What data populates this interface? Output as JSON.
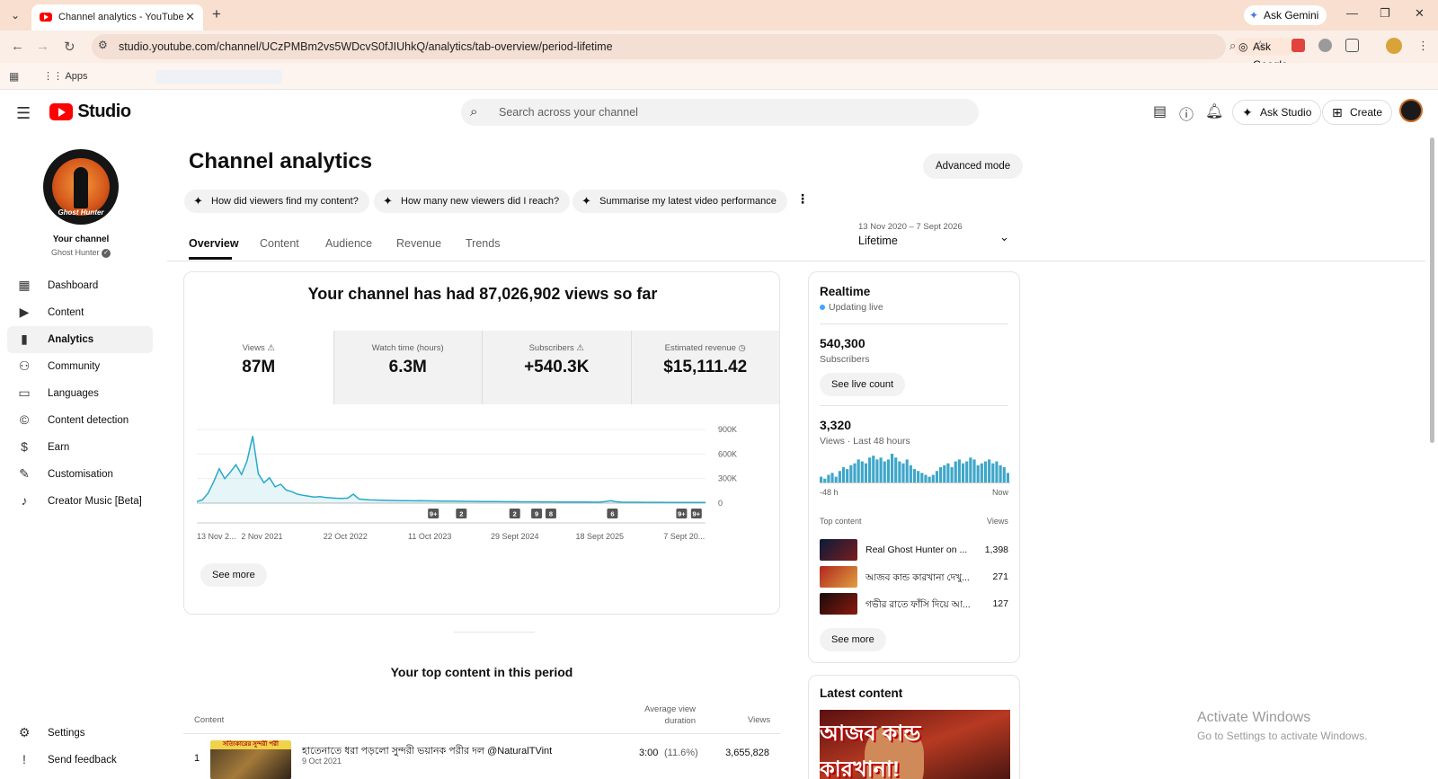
{
  "browser": {
    "tab_title": "Channel analytics - YouTube Studio",
    "ask_gemini": "Ask Gemini",
    "url": "studio.youtube.com/channel/UCzPMBm2vs5WDcvS0fJIUhkQ/analytics/tab-overview/period-lifetime",
    "ask_google": "Ask Google",
    "bookmarks_apps": "Apps"
  },
  "header": {
    "logo_text": "Studio",
    "search_placeholder": "Search across your channel",
    "ask_studio": "Ask Studio",
    "create": "Create"
  },
  "sidebar": {
    "your_channel": "Your channel",
    "channel_name": "Ghost Hunter",
    "avatar_caption": "Ghost Hunter",
    "items": [
      {
        "label": "Dashboard",
        "icon": "dashboard-icon"
      },
      {
        "label": "Content",
        "icon": "content-icon"
      },
      {
        "label": "Analytics",
        "icon": "analytics-icon",
        "active": true
      },
      {
        "label": "Community",
        "icon": "community-icon"
      },
      {
        "label": "Languages",
        "icon": "languages-icon"
      },
      {
        "label": "Content detection",
        "icon": "copyright-icon"
      },
      {
        "label": "Earn",
        "icon": "dollar-icon"
      },
      {
        "label": "Customisation",
        "icon": "wand-icon"
      },
      {
        "label": "Creator Music [Beta]",
        "icon": "music-icon"
      }
    ],
    "settings": "Settings",
    "feedback": "Send feedback"
  },
  "main": {
    "title": "Channel analytics",
    "advanced_mode": "Advanced mode",
    "chips": [
      "How did viewers find my content?",
      "How many new viewers did I reach?",
      "Summarise my latest video performance"
    ],
    "tabs": [
      "Overview",
      "Content",
      "Audience",
      "Revenue",
      "Trends"
    ],
    "date_range": "13 Nov 2020 – 7 Sept 2026",
    "period": "Lifetime",
    "views_headline": "Your channel has had 87,026,902 views so far",
    "metrics": [
      {
        "label": "Views",
        "value": "87M"
      },
      {
        "label": "Watch time (hours)",
        "value": "6.3M"
      },
      {
        "label": "Subscribers",
        "value": "+540.3K"
      },
      {
        "label": "Estimated revenue",
        "value": "$15,111.42"
      }
    ],
    "see_more": "See more",
    "top_content_title": "Your top content in this period",
    "top_content_headers": {
      "content": "Content",
      "avg_duration": "Average view duration",
      "views": "Views"
    },
    "top_content_rows": [
      {
        "rank": "1",
        "thumb_text": "সত্যিকারের সুন্দরী পরী",
        "title": "হাতেনাতে ধরা পড়লো সুন্দরী ভয়ানক পরীর দল @NaturalTVint",
        "date": "9 Oct 2021",
        "duration": "3:00",
        "pct": "(11.6%)",
        "views": "3,655,828"
      }
    ]
  },
  "chart_data": {
    "type": "line",
    "x_ticks": [
      "13 Nov 2...",
      "2 Nov 2021",
      "22 Oct 2022",
      "11 Oct 2023",
      "29 Sept 2024",
      "18 Sept 2025",
      "7 Sept 20..."
    ],
    "y_ticks": [
      "900K",
      "600K",
      "300K",
      "0"
    ],
    "ylim": [
      0,
      900000
    ],
    "series": [
      {
        "values": [
          20000,
          40000,
          120000,
          260000,
          420000,
          300000,
          380000,
          470000,
          350000,
          520000,
          820000,
          360000,
          250000,
          310000,
          200000,
          230000,
          160000,
          140000,
          110000,
          95000,
          85000,
          75000,
          80000,
          70000,
          65000,
          60000,
          58000,
          62000,
          110000,
          50000,
          45000,
          40000,
          38000,
          36000,
          34000,
          33000,
          32000,
          31000,
          30000,
          29000,
          30000,
          28000,
          27000,
          26000,
          25000,
          24000,
          25000,
          23000,
          22000,
          22000,
          21000,
          20000,
          20000,
          19000,
          19000,
          18000,
          18000,
          18000,
          17000,
          17000,
          16000,
          16000,
          15000,
          15000,
          15000,
          14000,
          14000,
          14000,
          13000,
          13000,
          13000,
          12000,
          12000,
          20000,
          30000,
          18000,
          12000,
          11000,
          11000,
          11000,
          10000,
          10000,
          10000,
          10000,
          9000,
          9000,
          9000,
          9000,
          8000,
          8000,
          8000,
          8000
        ]
      }
    ],
    "markers": [
      "9+",
      "2",
      "2",
      "9",
      "8",
      "6",
      "9+",
      "9+"
    ]
  },
  "realtime": {
    "title": "Realtime",
    "status": "Updating live",
    "subs_value": "540,300",
    "subs_label": "Subscribers",
    "see_live": "See live count",
    "views_value": "3,320",
    "views_label": "Views · Last 48 hours",
    "axis_left": "-48 h",
    "axis_right": "Now",
    "bars": [
      3,
      2,
      4,
      5,
      3,
      6,
      8,
      7,
      9,
      10,
      12,
      11,
      10,
      13,
      14,
      12,
      13,
      11,
      12,
      15,
      13,
      11,
      10,
      12,
      9,
      7,
      6,
      5,
      4,
      3,
      4,
      6,
      8,
      9,
      10,
      8,
      11,
      12,
      10,
      11,
      13,
      12,
      9,
      10,
      11,
      12,
      10,
      11,
      9,
      8,
      5
    ],
    "top_content_label": "Top content",
    "top_views_label": "Views",
    "top_items": [
      {
        "title": "Real Ghost Hunter on ...",
        "views": "1,398"
      },
      {
        "title": "আজব কান্ড কারখানা দেখু...",
        "views": "271"
      },
      {
        "title": "গভীর রাতে ফাঁসি দিয়ে আ...",
        "views": "127"
      }
    ],
    "see_more": "See more"
  },
  "latest": {
    "title": "Latest content",
    "thumb_text": "আজব কান্ড কারখানা!"
  },
  "watermark": {
    "line1": "Activate Windows",
    "line2": "Go to Settings to activate Windows."
  }
}
